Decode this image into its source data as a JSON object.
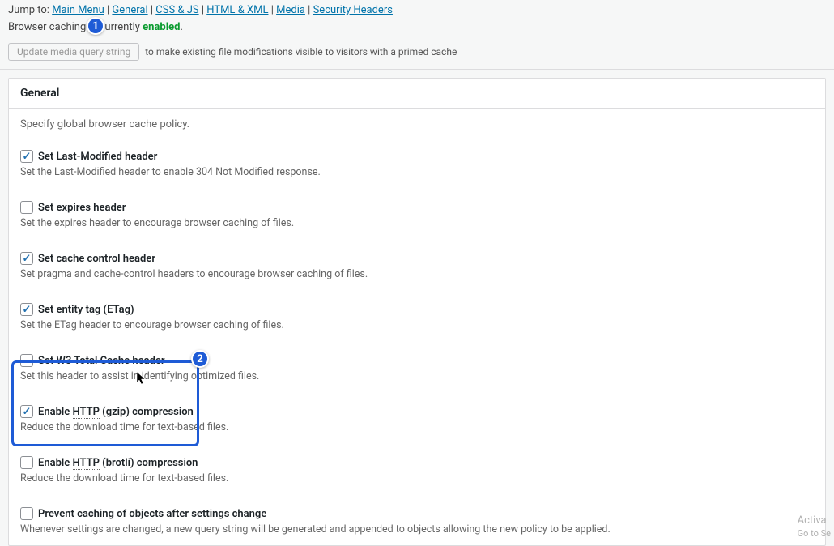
{
  "nav": {
    "prefix": "Jump to: ",
    "links": [
      "Main Menu",
      "General",
      "CSS & JS",
      "HTML & XML",
      "Media",
      "Security Headers"
    ]
  },
  "status": {
    "prefix": "Browser caching is currently ",
    "value": "enabled",
    "suffix": "."
  },
  "action": {
    "button": "Update media query string",
    "desc": " to make existing file modifications visible to visitors with a primed cache"
  },
  "section": {
    "title": "General",
    "desc": "Specify global browser cache policy."
  },
  "options": [
    {
      "checked": true,
      "label": "Set Last-Modified header",
      "desc": "Set the Last-Modified header to enable 304 Not Modified response."
    },
    {
      "checked": false,
      "label": "Set expires header",
      "desc": "Set the expires header to encourage browser caching of files."
    },
    {
      "checked": true,
      "label": "Set cache control header",
      "desc": "Set pragma and cache-control headers to encourage browser caching of files."
    },
    {
      "checked": true,
      "label": "Set entity tag (ETag)",
      "desc": "Set the ETag header to encourage browser caching of files."
    },
    {
      "checked": false,
      "label": "Set W3 Total Cache header",
      "desc": "Set this header to assist in identifying optimized files."
    },
    {
      "checked": true,
      "label_pre": "Enable ",
      "label_dotted": "HTTP",
      "label_post": " (gzip) compression",
      "desc": "Reduce the download time for text-based files."
    },
    {
      "checked": false,
      "label_pre": "Enable ",
      "label_dotted": "HTTP",
      "label_post": " (brotli) compression",
      "desc": "Reduce the download time for text-based files."
    },
    {
      "checked": false,
      "label": "Prevent caching of objects after settings change",
      "desc": "Whenever settings are changed, a new query string will be generated and appended to objects allowing the new policy to be applied."
    }
  ],
  "markers": {
    "one": "1",
    "two": "2"
  },
  "watermark": {
    "l1": "Activa",
    "l2": "Go to Se"
  }
}
